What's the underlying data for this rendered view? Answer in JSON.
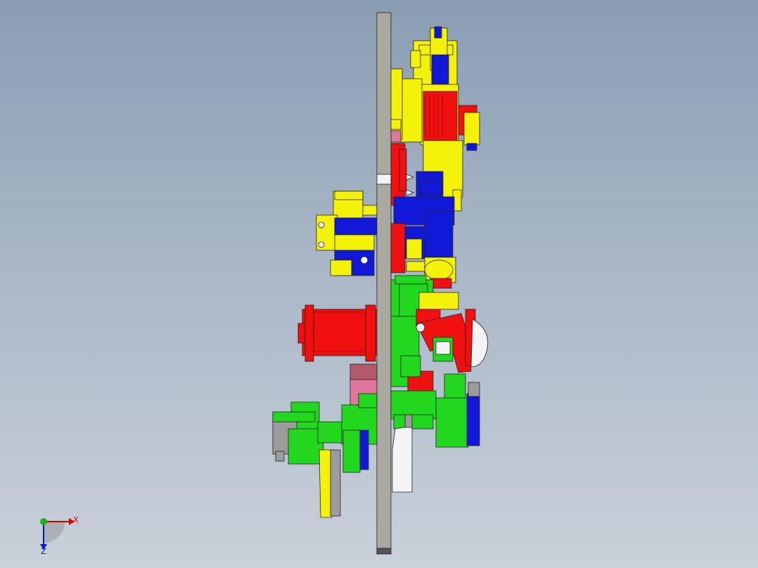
{
  "viewport": {
    "background_top": "#8a9db3",
    "background_bottom": "#c9d1da"
  },
  "model": {
    "colors": {
      "yellow": "#f5f20a",
      "red": "#f01010",
      "blue": "#1218d8",
      "green": "#22d81e",
      "pink": "#e2779c",
      "plate": "#a9a9a2",
      "gray": "#9c9c9c",
      "white": "#f4f4f4",
      "darkpink": "#b05a6c"
    }
  },
  "triad": {
    "x_label": "X",
    "z_label": "Z",
    "x_color": "#d00000",
    "y_color": "#18b818",
    "z_color": "#0018c8"
  }
}
